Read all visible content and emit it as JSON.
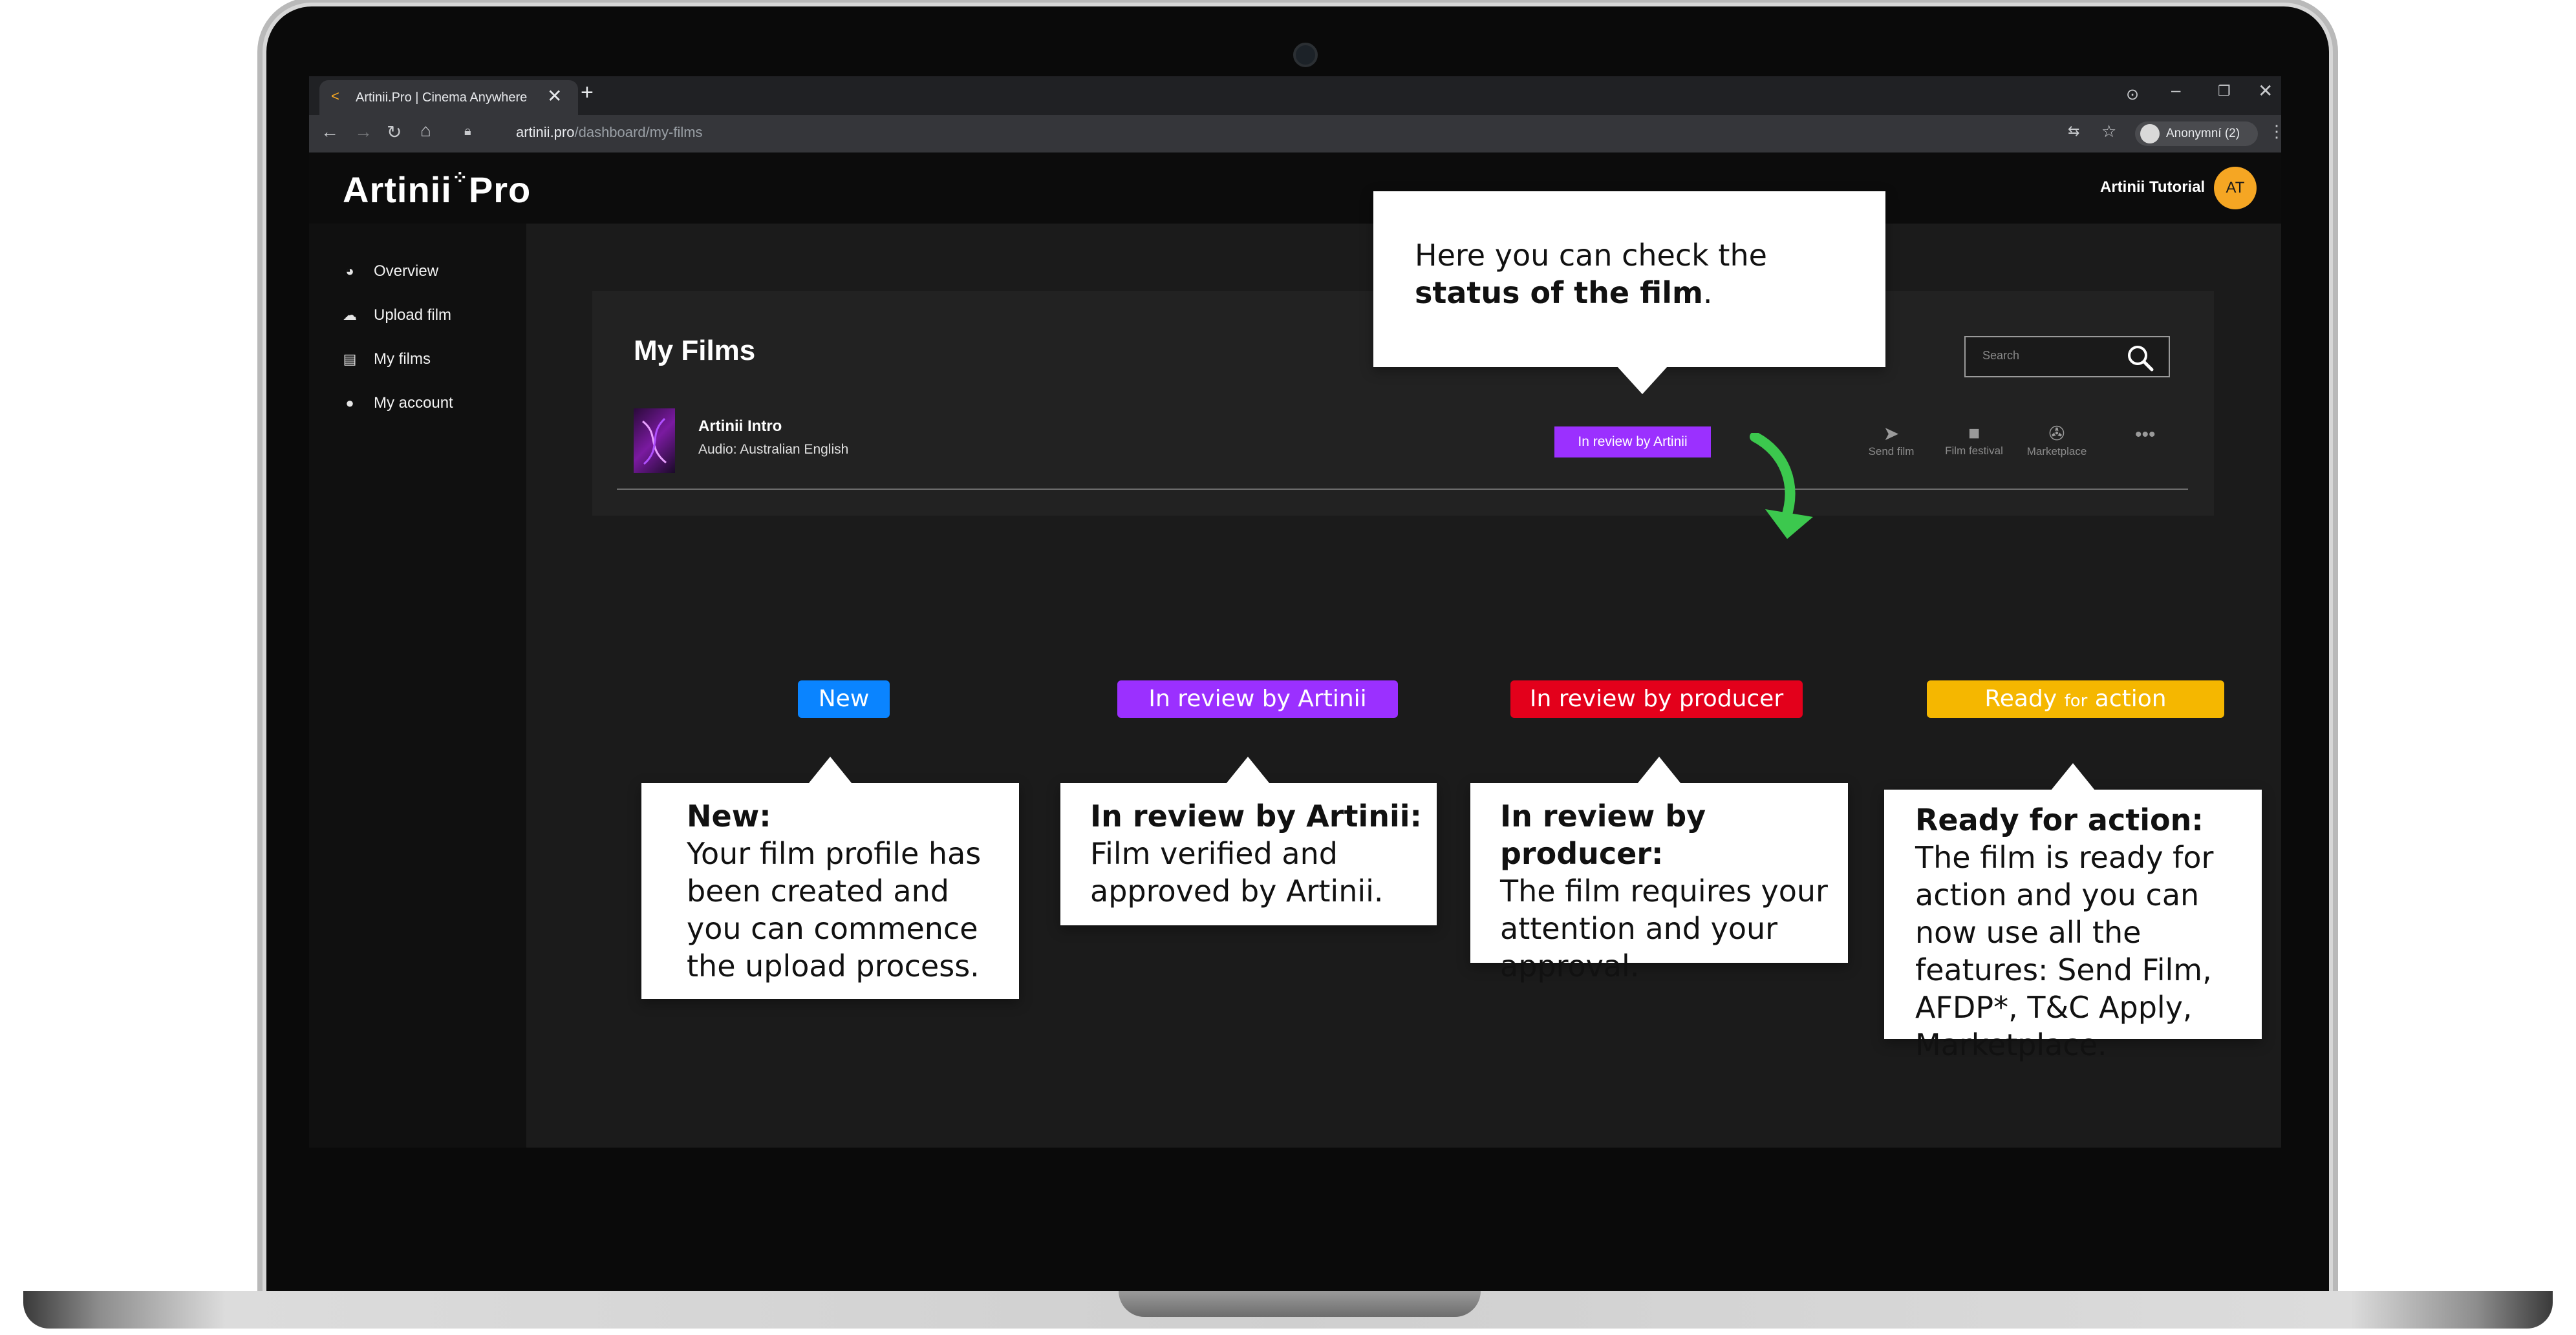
{
  "browser": {
    "tab_title": "Artinii.Pro | Cinema Anywhere",
    "url_host": "artinii.pro",
    "url_path": "/dashboard/my-films",
    "profile": "Anonymní (2)"
  },
  "app": {
    "logo": "Artinii",
    "logo_suffix": "Pro",
    "user_name": "Artinii Tutorial",
    "user_initials": "AT",
    "accent_color": "#f5a623"
  },
  "sidebar": {
    "items": [
      {
        "label": "Overview",
        "icon": "dashboard-icon"
      },
      {
        "label": "Upload film",
        "icon": "cloud-upload-icon"
      },
      {
        "label": "My films",
        "icon": "film-icon"
      },
      {
        "label": "My account",
        "icon": "user-icon"
      }
    ]
  },
  "films": {
    "title": "My Films",
    "search_placeholder": "Search",
    "rows": [
      {
        "title": "Artinii Intro",
        "audio": "Audio: Australian English",
        "status": "In review by Artinii",
        "status_color": "#9b30ff"
      }
    ],
    "actions": [
      {
        "label": "Send film",
        "icon": "paper-plane-icon"
      },
      {
        "label": "Film festival",
        "icon": "camera-icon"
      },
      {
        "label": "Marketplace",
        "icon": "film-reel-icon"
      }
    ]
  },
  "callout_status": {
    "text_pre": "Here you can check the ",
    "text_bold": "status of the film",
    "text_post": "."
  },
  "statuses": [
    {
      "label": "New",
      "color": "#0a84ff",
      "heading": "New:",
      "body": "Your film profile has been created and you can commence the upload process."
    },
    {
      "label": "In review by Artinii",
      "color": "#9b30ff",
      "heading": "In review by Artinii:",
      "body": "Film verified and approved by Artinii."
    },
    {
      "label": "In review by producer",
      "color": "#e3001b",
      "heading": "In review by producer:",
      "body": "The film requires your attention and your approval."
    },
    {
      "label_main": "Ready",
      "label_small": "for",
      "label_end": "action",
      "color": "#f5b700",
      "heading": "Ready for action:",
      "body": "The film is ready for action and you can now use all the features: Send Film, AFDP*, T&C Apply, Marketplace."
    }
  ]
}
